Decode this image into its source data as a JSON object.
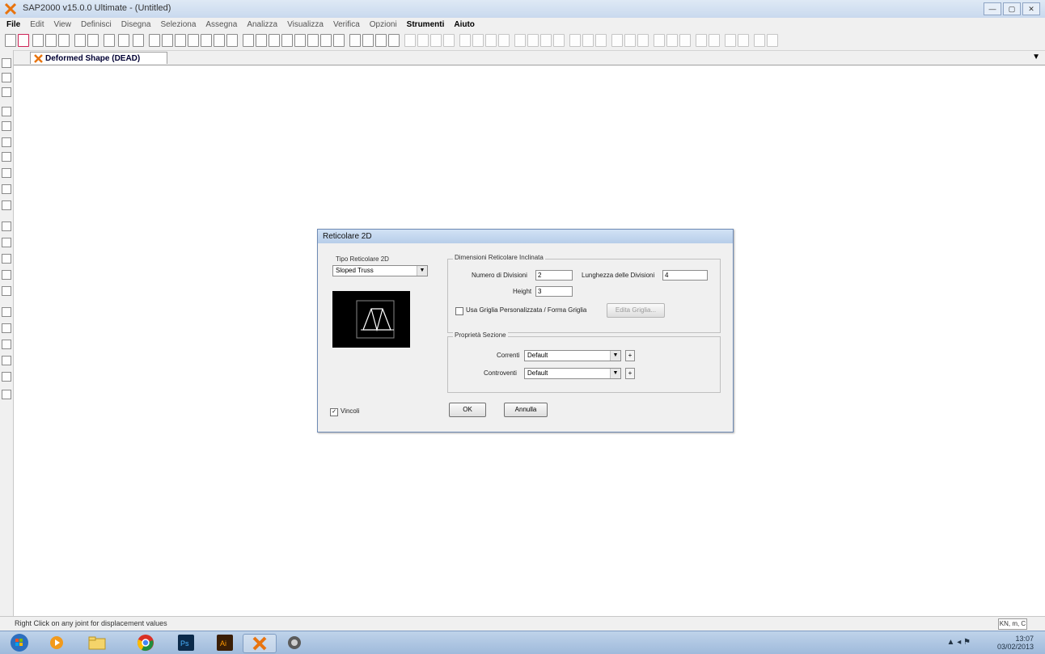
{
  "window": {
    "title": "SAP2000 v15.0.0 Ultimate - (Untitled)",
    "buttons": [
      "—",
      "▢",
      "✕"
    ]
  },
  "menu": [
    "File",
    "Edit",
    "View",
    "Definisci",
    "Disegna",
    "Seleziona",
    "Assegna",
    "Analizza",
    "Visualizza",
    "Verifica",
    "Opzioni",
    "Strumenti",
    "Aiuto"
  ],
  "tab": {
    "label": "Deformed Shape (DEAD)",
    "arrow": "▼"
  },
  "dialog": {
    "title": "Reticolare 2D",
    "type_group": "Tipo Reticolare 2D",
    "type_value": "Sloped Truss",
    "dims_group": "Dimensioni Reticolare Inclinata",
    "num_div_label": "Numero di Divisioni",
    "num_div_value": "2",
    "length_label": "Lunghezza delle Divisioni",
    "length_value": "4",
    "height_label": "Height",
    "height_value": "3",
    "custom_grid_label": "Usa Griglia Personalizzata / Forma Griglia",
    "custom_grid_checked": false,
    "edit_grid_label": "Edita Griglia...",
    "section_group": "Proprietà Sezione",
    "corrent_label": "Correnti",
    "corrent_value": "Default",
    "diagonal_label": "Controventi",
    "diagonal_value": "Default",
    "restraints_label": "Vincoli",
    "restraints_checked": true,
    "ok_label": "OK",
    "cancel_label": "Annulla"
  },
  "status": {
    "text": "Right Click on any joint for displacement values",
    "units": "KN, m, C"
  },
  "tray": {
    "time": "13:07",
    "date": "03/02/2013"
  },
  "colors": {
    "taskbar": "#9fbadb",
    "titlebar": "#c9d9ee",
    "dialog_bg": "#f0f0f0",
    "preview_bg": "#000000"
  }
}
